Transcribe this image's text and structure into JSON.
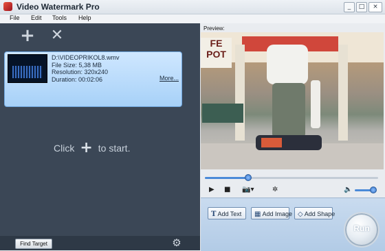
{
  "window": {
    "title": "Video Watermark Pro",
    "buttons": [
      "_",
      "□",
      "×"
    ]
  },
  "menu": [
    "File",
    "Edit",
    "Tools",
    "Help"
  ],
  "left_panel": {
    "toolbar": {
      "add_icon": "plus-icon",
      "remove_icon": "x-icon"
    },
    "file": {
      "path": "D:\\VIDEOPRIKOL8.wmv",
      "size": "File Size: 5,38 MB",
      "resolution": "Resolution: 320x240",
      "duration": "Duration: 00:02:06",
      "more": "More..."
    },
    "hint_before": "Click",
    "hint_after": "to start.",
    "find_target": "Find Target"
  },
  "preview": {
    "label": "Preview:",
    "seek_progress": 0.25,
    "volume": 0.9
  },
  "actions": {
    "add_text": "Add Text",
    "add_image": "Add Image",
    "add_shape": "Add Shape",
    "run": "Run"
  },
  "colors": {
    "panel": "#3b4756",
    "accent": "#4a8ad8",
    "selection": "#a7d1f8"
  }
}
